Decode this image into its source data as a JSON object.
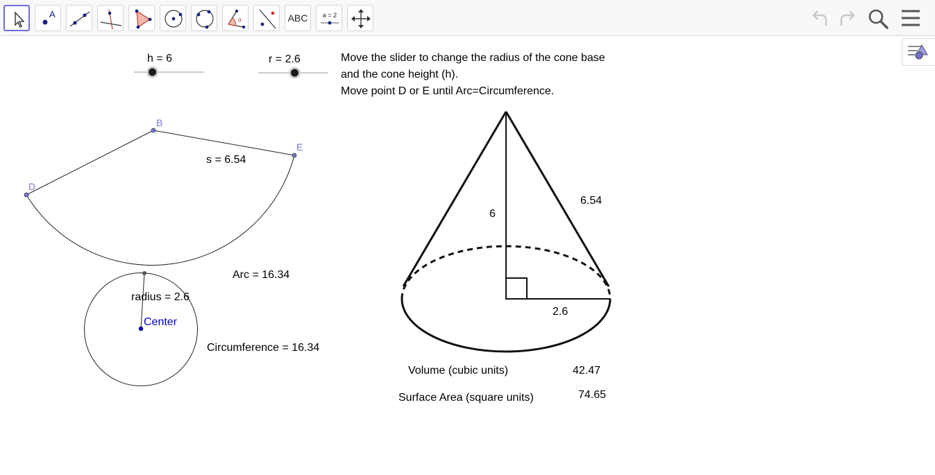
{
  "toolbar": {
    "tools": [
      {
        "name": "move-tool",
        "icon": "cursor-arrow-icon",
        "selected": true
      },
      {
        "name": "point-tool",
        "icon": "point-a-icon",
        "label": "A"
      },
      {
        "name": "line-tool",
        "icon": "line-through-points-icon"
      },
      {
        "name": "perpendicular-tool",
        "icon": "perpendicular-line-icon"
      },
      {
        "name": "polygon-tool",
        "icon": "polygon-icon"
      },
      {
        "name": "circle-center-tool",
        "icon": "circle-center-point-icon"
      },
      {
        "name": "circle-three-points-tool",
        "icon": "circle-three-points-icon"
      },
      {
        "name": "angle-tool",
        "icon": "angle-icon"
      },
      {
        "name": "reflect-tool",
        "icon": "reflect-about-line-icon"
      },
      {
        "name": "text-tool",
        "icon": "text-icon",
        "label": "ABC"
      },
      {
        "name": "slider-tool",
        "icon": "slider-icon",
        "label": "a = 2"
      },
      {
        "name": "move-view-tool",
        "icon": "move-graphics-view-icon"
      }
    ],
    "right": [
      "undo-icon",
      "redo-icon",
      "search-icon",
      "menu-icon"
    ]
  },
  "style_bar": {
    "icon": "style-bar-toggle-icon"
  },
  "sliders": {
    "h": {
      "label": "h = 6",
      "value": 6,
      "min": 1,
      "max": 20
    },
    "r": {
      "label": "r = 2.6",
      "value": 2.6,
      "min": 0,
      "max": 5
    }
  },
  "instructions": [
    "Move the slider to change the radius of the cone base",
    "and the cone height (h).",
    "Move point D or E until Arc=Circumference."
  ],
  "net": {
    "points": {
      "B": "B",
      "D": "D",
      "E": "E",
      "center": "Center"
    },
    "s_label": "s = 6.54",
    "arc_label": "Arc = 16.34",
    "radius_label": "radius = 2.6",
    "circumference_label": "Circumference = 16.34"
  },
  "cone": {
    "height_label": "6",
    "slant_label": "6.54",
    "radius_label": "2.6"
  },
  "measures": {
    "volume_label": "Volume (cubic units)",
    "volume_value": "42.47",
    "surface_label": "Surface Area (square units)",
    "surface_value": "74.65"
  },
  "colors": {
    "point_label": "#7777dd",
    "center_label": "#0000cc",
    "slider_knob": "#1a1a1a",
    "selected_tool_border": "#6d6dd8"
  }
}
